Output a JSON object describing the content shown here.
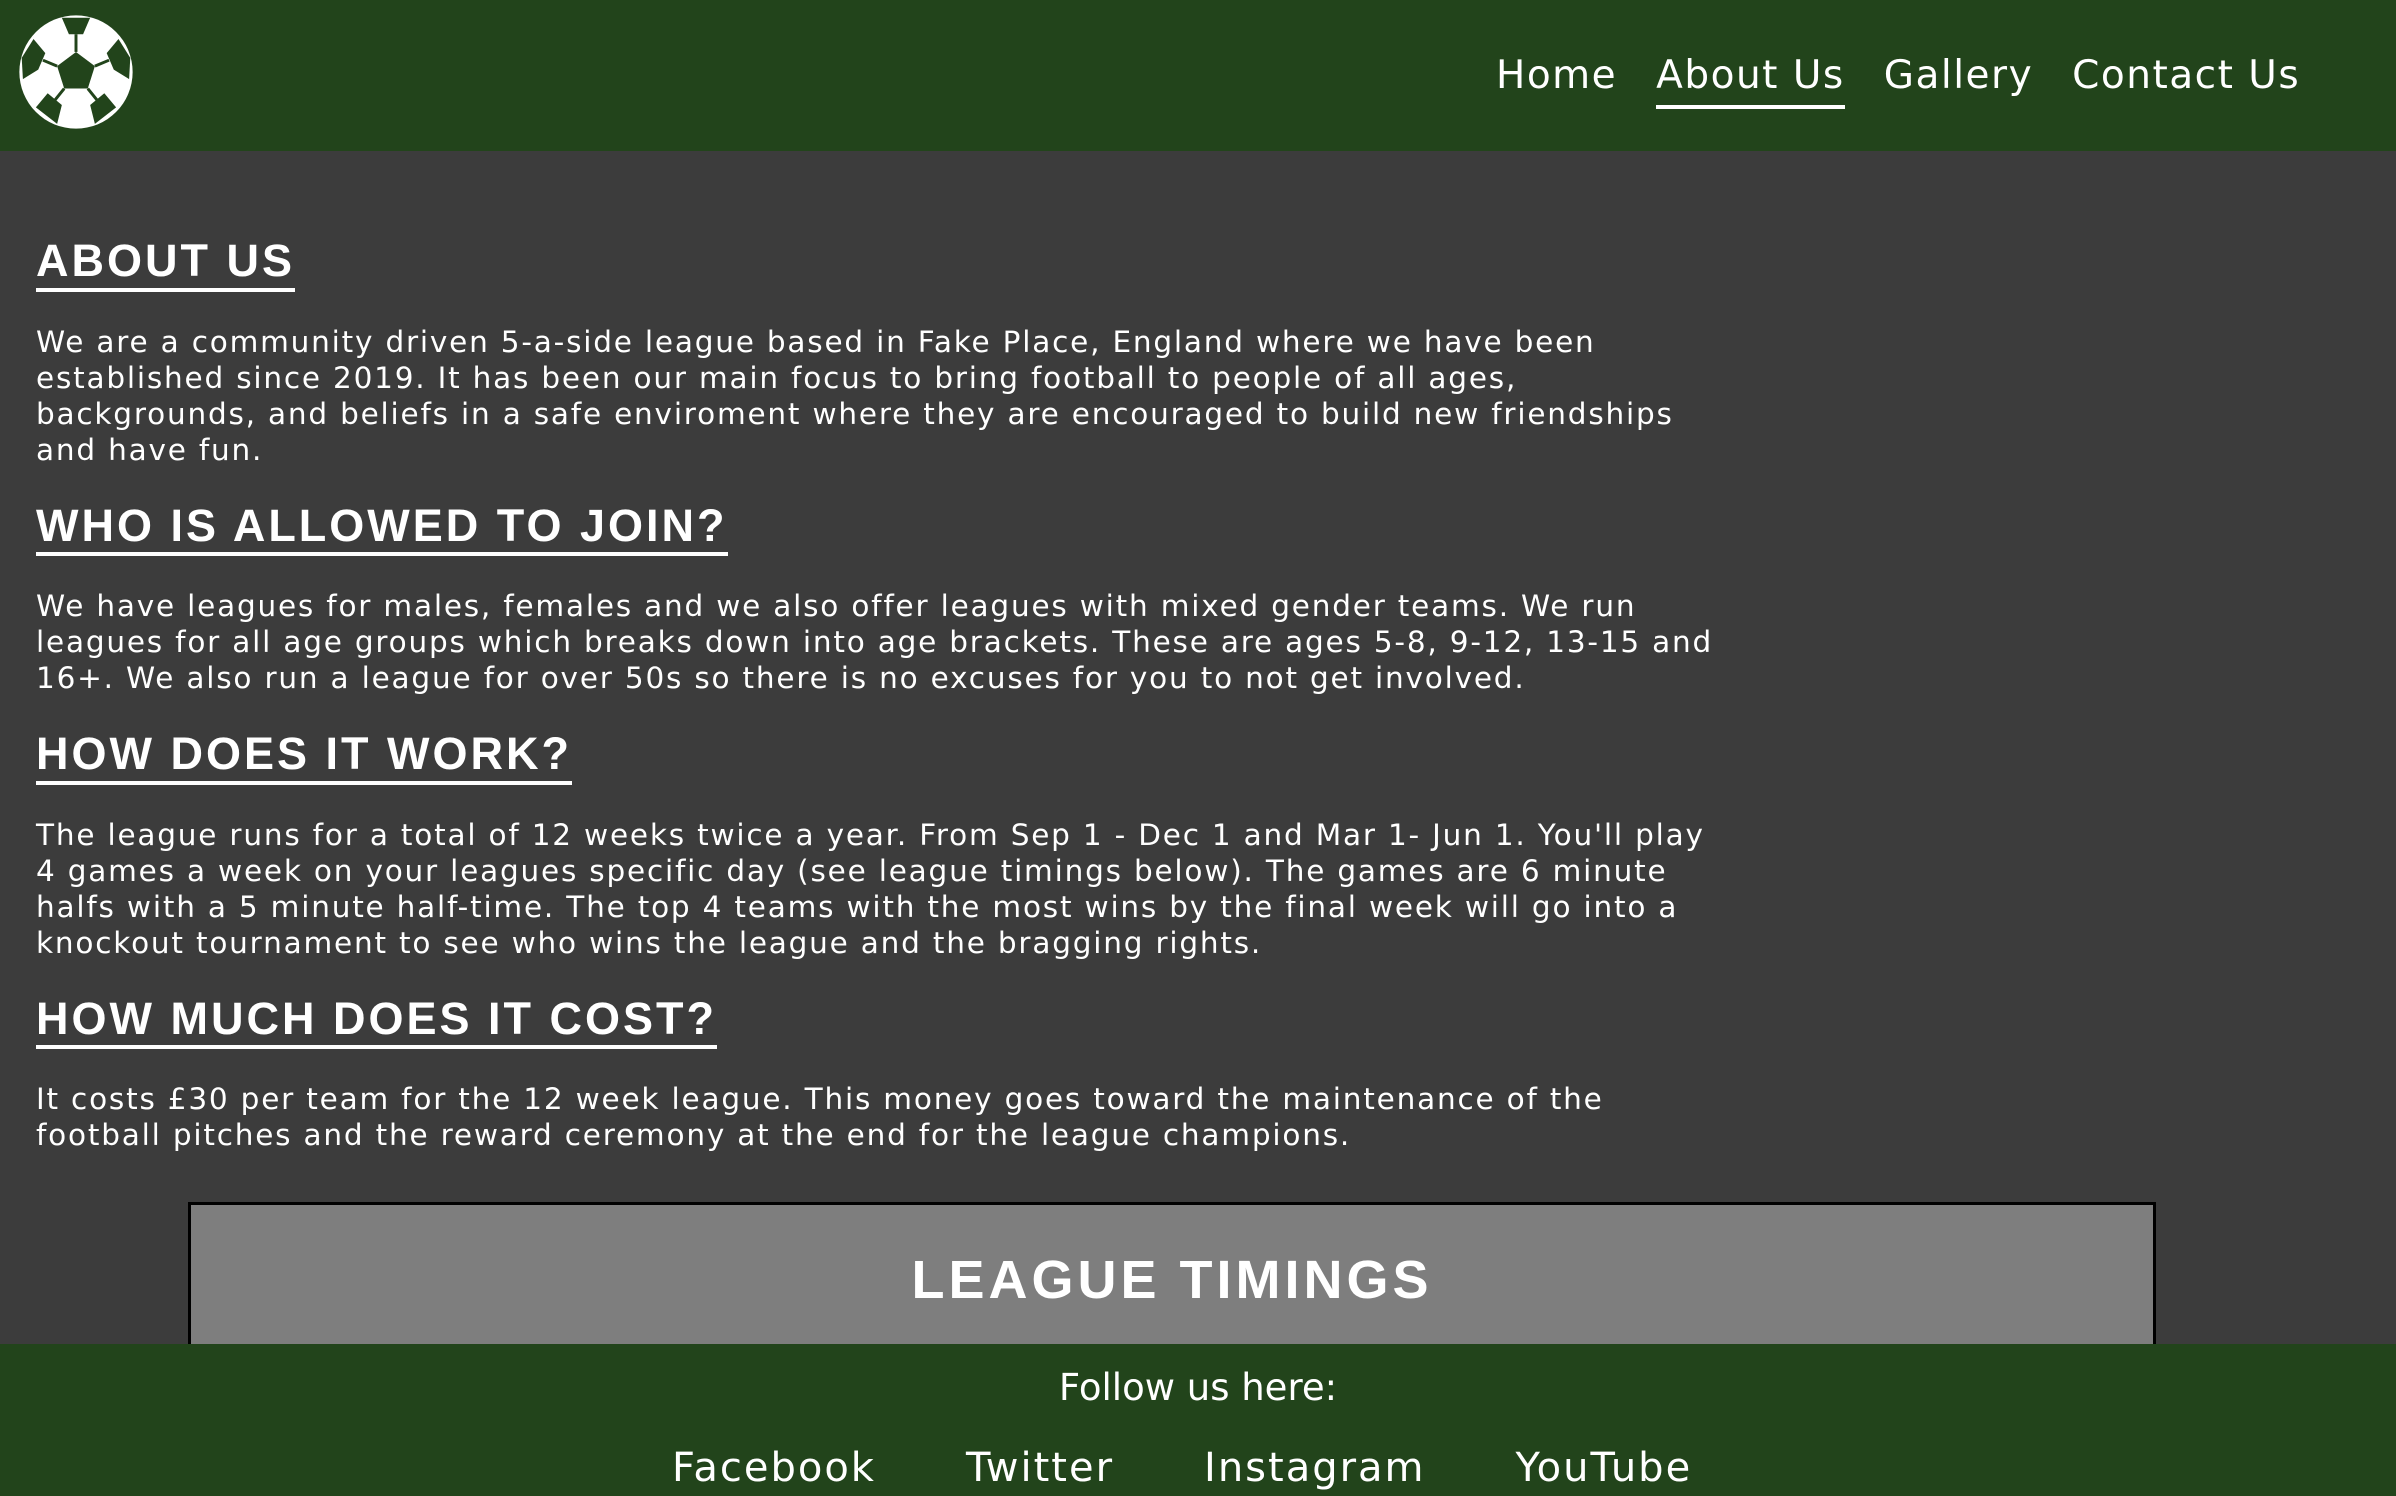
{
  "header": {
    "logo_icon": "soccer-ball-icon",
    "nav": [
      {
        "label": "Home",
        "active": false
      },
      {
        "label": "About Us",
        "active": true
      },
      {
        "label": "Gallery",
        "active": false
      },
      {
        "label": "Contact Us",
        "active": false
      }
    ],
    "background_color": "#22441b"
  },
  "main": {
    "sections": [
      {
        "heading": "ABOUT US",
        "body": "We are a community driven 5-a-side league based in Fake Place, England where we have been established since 2019. It has been our main focus to bring football to people of all ages, backgrounds, and beliefs in a safe enviroment where they are encouraged to build new friendships and have fun."
      },
      {
        "heading": "WHO IS ALLOWED TO JOIN?",
        "body": "We have leagues for males, females and we also offer leagues with mixed gender teams. We run leagues for all age groups which breaks down into age brackets. These are ages 5-8, 9-12, 13-15 and 16+. We also run a league for over 50s so there is no excuses for you to not get involved."
      },
      {
        "heading": "HOW DOES IT WORK?",
        "body": "The league runs for a total of 12 weeks twice a year. From Sep 1 - Dec 1 and Mar 1- Jun 1. You'll play 4 games a week on your leagues specific day (see league timings below). The games are 6 minute halfs with a 5 minute half-time. The top 4 teams with the most wins by the final week will go into a knockout tournament to see who wins the league and the bragging rights."
      },
      {
        "heading": "HOW MUCH DOES IT COST?",
        "body": "It costs £30 per team for the 12 week league. This money goes toward the maintenance of the football pitches and the reward ceremony at the end for the league champions."
      }
    ],
    "timings_title": "LEAGUE TIMINGS"
  },
  "footer": {
    "follow_text": "Follow us here:",
    "social": [
      "Facebook",
      "Twitter",
      "Instagram",
      "YouTube"
    ]
  },
  "colors": {
    "header_footer_green": "#22441b",
    "content_background": "#3c3c3c",
    "timings_box": "#7e7e7e"
  }
}
